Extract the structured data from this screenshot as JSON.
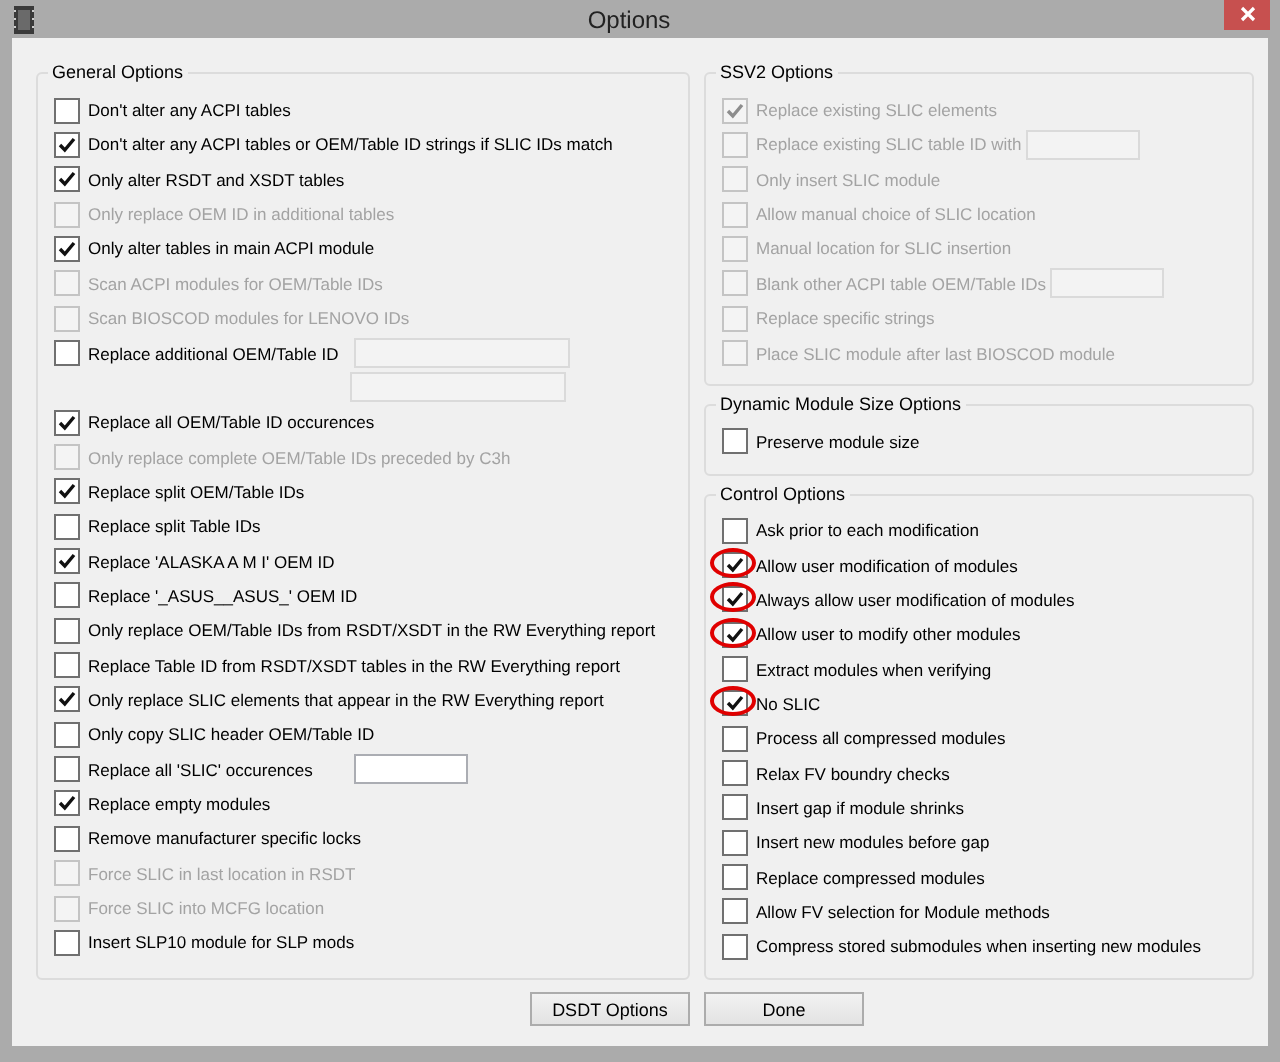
{
  "window": {
    "title": "Options"
  },
  "general_options": {
    "title": "General Options",
    "items": [
      {
        "label": "Don't alter any ACPI tables",
        "kind": "checkbox",
        "checked": false,
        "disabled": false
      },
      {
        "label": "Don't alter any ACPI tables or OEM/Table ID strings if SLIC IDs match",
        "kind": "checkbox",
        "checked": true,
        "disabled": false
      },
      {
        "label": "Only alter RSDT and XSDT tables",
        "kind": "checkbox",
        "checked": true,
        "disabled": false
      },
      {
        "label": "Only replace OEM ID in additional tables",
        "kind": "checkbox",
        "checked": false,
        "disabled": true
      },
      {
        "label": "Only alter tables in main ACPI module",
        "kind": "checkbox",
        "checked": true,
        "disabled": false
      },
      {
        "label": "Scan ACPI modules for OEM/Table IDs",
        "kind": "checkbox",
        "checked": false,
        "disabled": true
      },
      {
        "label": "Scan BIOSCOD modules for LENOVO IDs",
        "kind": "checkbox",
        "checked": false,
        "disabled": true
      },
      {
        "label": "Replace additional OEM/Table ID",
        "kind": "field-pair",
        "checked": false,
        "disabled": false,
        "field_disabled": true
      },
      {
        "label": "Replace all OEM/Table ID occurences",
        "kind": "checkbox",
        "checked": true,
        "disabled": false
      },
      {
        "label": "Only replace complete OEM/Table IDs preceded by C3h",
        "kind": "checkbox",
        "checked": false,
        "disabled": true
      },
      {
        "label": "Replace split OEM/Table IDs",
        "kind": "checkbox",
        "checked": true,
        "disabled": false
      },
      {
        "label": "Replace split Table IDs",
        "kind": "checkbox",
        "checked": false,
        "disabled": false
      },
      {
        "label": "Replace 'ALASKA A M I' OEM ID",
        "kind": "checkbox",
        "checked": true,
        "disabled": false
      },
      {
        "label": "Replace '_ASUS__ASUS_' OEM ID",
        "kind": "checkbox",
        "checked": false,
        "disabled": false
      },
      {
        "label": "Only replace OEM/Table IDs from RSDT/XSDT in the RW Everything report",
        "kind": "checkbox",
        "checked": false,
        "disabled": false
      },
      {
        "label": "Replace Table ID from RSDT/XSDT tables in the RW Everything report",
        "kind": "checkbox",
        "checked": false,
        "disabled": false
      },
      {
        "label": "Only replace SLIC elements that appear in the RW Everything report",
        "kind": "checkbox",
        "checked": true,
        "disabled": false
      },
      {
        "label": "Only copy SLIC header OEM/Table ID",
        "kind": "checkbox",
        "checked": false,
        "disabled": false
      },
      {
        "label": "Replace all 'SLIC' occurences",
        "kind": "field-narrow",
        "checked": false,
        "disabled": false,
        "field_disabled": false
      },
      {
        "label": "Replace empty modules",
        "kind": "checkbox",
        "checked": true,
        "disabled": false
      },
      {
        "label": "Remove manufacturer specific locks",
        "kind": "checkbox",
        "checked": false,
        "disabled": false
      },
      {
        "label": "Force SLIC in last location in RSDT",
        "kind": "checkbox",
        "checked": false,
        "disabled": true
      },
      {
        "label": "Force SLIC into MCFG location",
        "kind": "checkbox",
        "checked": false,
        "disabled": true
      },
      {
        "label": "Insert SLP10 module for SLP mods",
        "kind": "checkbox",
        "checked": false,
        "disabled": false
      }
    ]
  },
  "ssv2_options": {
    "title": "SSV2 Options",
    "items": [
      {
        "label": "Replace existing SLIC elements",
        "kind": "checkbox",
        "checked": true,
        "disabled": true
      },
      {
        "label": "Replace existing SLIC table ID with",
        "kind": "field-narrow",
        "checked": false,
        "disabled": true,
        "field_disabled": true
      },
      {
        "label": "Only insert SLIC module",
        "kind": "checkbox",
        "checked": false,
        "disabled": true
      },
      {
        "label": "Allow manual choice of SLIC location",
        "kind": "checkbox",
        "checked": false,
        "disabled": true
      },
      {
        "label": "Manual location for SLIC insertion",
        "kind": "checkbox",
        "checked": false,
        "disabled": true
      },
      {
        "label": "Blank other ACPI table OEM/Table IDs",
        "kind": "field-narrow",
        "checked": false,
        "disabled": true,
        "field_disabled": true
      },
      {
        "label": "Replace specific strings",
        "kind": "checkbox",
        "checked": false,
        "disabled": true
      },
      {
        "label": "Place SLIC module after last BIOSCOD module",
        "kind": "checkbox",
        "checked": false,
        "disabled": true
      }
    ]
  },
  "dynamic_module_size_options": {
    "title": "Dynamic Module Size Options",
    "items": [
      {
        "label": "Preserve module size",
        "kind": "checkbox",
        "checked": false,
        "disabled": false
      }
    ]
  },
  "control_options": {
    "title": "Control Options",
    "items": [
      {
        "label": "Ask prior to each modification",
        "kind": "checkbox",
        "checked": false,
        "disabled": false,
        "highlighted": false
      },
      {
        "label": "Allow user modification of modules",
        "kind": "checkbox",
        "checked": true,
        "disabled": false,
        "highlighted": true
      },
      {
        "label": "Always allow user modification of modules",
        "kind": "checkbox",
        "checked": true,
        "disabled": false,
        "highlighted": true
      },
      {
        "label": "Allow user to modify other modules",
        "kind": "checkbox",
        "checked": true,
        "disabled": false,
        "highlighted": true
      },
      {
        "label": "Extract modules when verifying",
        "kind": "checkbox",
        "checked": false,
        "disabled": false,
        "highlighted": false
      },
      {
        "label": "No SLIC",
        "kind": "checkbox",
        "checked": true,
        "disabled": false,
        "highlighted": true
      },
      {
        "label": "Process all compressed modules",
        "kind": "checkbox",
        "checked": false,
        "disabled": false,
        "highlighted": false
      },
      {
        "label": "Relax FV boundry checks",
        "kind": "checkbox",
        "checked": false,
        "disabled": false,
        "highlighted": false
      },
      {
        "label": "Insert gap if module shrinks",
        "kind": "checkbox",
        "checked": false,
        "disabled": false,
        "highlighted": false
      },
      {
        "label": "Insert new modules before gap",
        "kind": "checkbox",
        "checked": false,
        "disabled": false,
        "highlighted": false
      },
      {
        "label": "Replace compressed modules",
        "kind": "checkbox",
        "checked": false,
        "disabled": false,
        "highlighted": false
      },
      {
        "label": "Allow FV selection for Module methods",
        "kind": "checkbox",
        "checked": false,
        "disabled": false,
        "highlighted": false
      },
      {
        "label": "Compress stored submodules when inserting new modules",
        "kind": "checkbox",
        "checked": false,
        "disabled": false,
        "highlighted": false
      }
    ]
  },
  "buttons": [
    "DSDT Options",
    "Done"
  ]
}
